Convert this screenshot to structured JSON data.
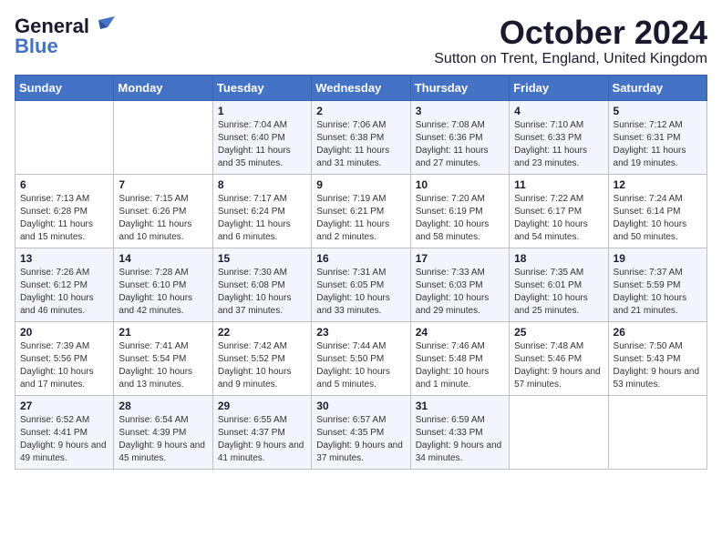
{
  "logo": {
    "general": "General",
    "blue": "Blue"
  },
  "title": "October 2024",
  "location": "Sutton on Trent, England, United Kingdom",
  "days_of_week": [
    "Sunday",
    "Monday",
    "Tuesday",
    "Wednesday",
    "Thursday",
    "Friday",
    "Saturday"
  ],
  "weeks": [
    [
      {
        "day": "",
        "sunrise": "",
        "sunset": "",
        "daylight": ""
      },
      {
        "day": "",
        "sunrise": "",
        "sunset": "",
        "daylight": ""
      },
      {
        "day": "1",
        "sunrise": "Sunrise: 7:04 AM",
        "sunset": "Sunset: 6:40 PM",
        "daylight": "Daylight: 11 hours and 35 minutes."
      },
      {
        "day": "2",
        "sunrise": "Sunrise: 7:06 AM",
        "sunset": "Sunset: 6:38 PM",
        "daylight": "Daylight: 11 hours and 31 minutes."
      },
      {
        "day": "3",
        "sunrise": "Sunrise: 7:08 AM",
        "sunset": "Sunset: 6:36 PM",
        "daylight": "Daylight: 11 hours and 27 minutes."
      },
      {
        "day": "4",
        "sunrise": "Sunrise: 7:10 AM",
        "sunset": "Sunset: 6:33 PM",
        "daylight": "Daylight: 11 hours and 23 minutes."
      },
      {
        "day": "5",
        "sunrise": "Sunrise: 7:12 AM",
        "sunset": "Sunset: 6:31 PM",
        "daylight": "Daylight: 11 hours and 19 minutes."
      }
    ],
    [
      {
        "day": "6",
        "sunrise": "Sunrise: 7:13 AM",
        "sunset": "Sunset: 6:28 PM",
        "daylight": "Daylight: 11 hours and 15 minutes."
      },
      {
        "day": "7",
        "sunrise": "Sunrise: 7:15 AM",
        "sunset": "Sunset: 6:26 PM",
        "daylight": "Daylight: 11 hours and 10 minutes."
      },
      {
        "day": "8",
        "sunrise": "Sunrise: 7:17 AM",
        "sunset": "Sunset: 6:24 PM",
        "daylight": "Daylight: 11 hours and 6 minutes."
      },
      {
        "day": "9",
        "sunrise": "Sunrise: 7:19 AM",
        "sunset": "Sunset: 6:21 PM",
        "daylight": "Daylight: 11 hours and 2 minutes."
      },
      {
        "day": "10",
        "sunrise": "Sunrise: 7:20 AM",
        "sunset": "Sunset: 6:19 PM",
        "daylight": "Daylight: 10 hours and 58 minutes."
      },
      {
        "day": "11",
        "sunrise": "Sunrise: 7:22 AM",
        "sunset": "Sunset: 6:17 PM",
        "daylight": "Daylight: 10 hours and 54 minutes."
      },
      {
        "day": "12",
        "sunrise": "Sunrise: 7:24 AM",
        "sunset": "Sunset: 6:14 PM",
        "daylight": "Daylight: 10 hours and 50 minutes."
      }
    ],
    [
      {
        "day": "13",
        "sunrise": "Sunrise: 7:26 AM",
        "sunset": "Sunset: 6:12 PM",
        "daylight": "Daylight: 10 hours and 46 minutes."
      },
      {
        "day": "14",
        "sunrise": "Sunrise: 7:28 AM",
        "sunset": "Sunset: 6:10 PM",
        "daylight": "Daylight: 10 hours and 42 minutes."
      },
      {
        "day": "15",
        "sunrise": "Sunrise: 7:30 AM",
        "sunset": "Sunset: 6:08 PM",
        "daylight": "Daylight: 10 hours and 37 minutes."
      },
      {
        "day": "16",
        "sunrise": "Sunrise: 7:31 AM",
        "sunset": "Sunset: 6:05 PM",
        "daylight": "Daylight: 10 hours and 33 minutes."
      },
      {
        "day": "17",
        "sunrise": "Sunrise: 7:33 AM",
        "sunset": "Sunset: 6:03 PM",
        "daylight": "Daylight: 10 hours and 29 minutes."
      },
      {
        "day": "18",
        "sunrise": "Sunrise: 7:35 AM",
        "sunset": "Sunset: 6:01 PM",
        "daylight": "Daylight: 10 hours and 25 minutes."
      },
      {
        "day": "19",
        "sunrise": "Sunrise: 7:37 AM",
        "sunset": "Sunset: 5:59 PM",
        "daylight": "Daylight: 10 hours and 21 minutes."
      }
    ],
    [
      {
        "day": "20",
        "sunrise": "Sunrise: 7:39 AM",
        "sunset": "Sunset: 5:56 PM",
        "daylight": "Daylight: 10 hours and 17 minutes."
      },
      {
        "day": "21",
        "sunrise": "Sunrise: 7:41 AM",
        "sunset": "Sunset: 5:54 PM",
        "daylight": "Daylight: 10 hours and 13 minutes."
      },
      {
        "day": "22",
        "sunrise": "Sunrise: 7:42 AM",
        "sunset": "Sunset: 5:52 PM",
        "daylight": "Daylight: 10 hours and 9 minutes."
      },
      {
        "day": "23",
        "sunrise": "Sunrise: 7:44 AM",
        "sunset": "Sunset: 5:50 PM",
        "daylight": "Daylight: 10 hours and 5 minutes."
      },
      {
        "day": "24",
        "sunrise": "Sunrise: 7:46 AM",
        "sunset": "Sunset: 5:48 PM",
        "daylight": "Daylight: 10 hours and 1 minute."
      },
      {
        "day": "25",
        "sunrise": "Sunrise: 7:48 AM",
        "sunset": "Sunset: 5:46 PM",
        "daylight": "Daylight: 9 hours and 57 minutes."
      },
      {
        "day": "26",
        "sunrise": "Sunrise: 7:50 AM",
        "sunset": "Sunset: 5:43 PM",
        "daylight": "Daylight: 9 hours and 53 minutes."
      }
    ],
    [
      {
        "day": "27",
        "sunrise": "Sunrise: 6:52 AM",
        "sunset": "Sunset: 4:41 PM",
        "daylight": "Daylight: 9 hours and 49 minutes."
      },
      {
        "day": "28",
        "sunrise": "Sunrise: 6:54 AM",
        "sunset": "Sunset: 4:39 PM",
        "daylight": "Daylight: 9 hours and 45 minutes."
      },
      {
        "day": "29",
        "sunrise": "Sunrise: 6:55 AM",
        "sunset": "Sunset: 4:37 PM",
        "daylight": "Daylight: 9 hours and 41 minutes."
      },
      {
        "day": "30",
        "sunrise": "Sunrise: 6:57 AM",
        "sunset": "Sunset: 4:35 PM",
        "daylight": "Daylight: 9 hours and 37 minutes."
      },
      {
        "day": "31",
        "sunrise": "Sunrise: 6:59 AM",
        "sunset": "Sunset: 4:33 PM",
        "daylight": "Daylight: 9 hours and 34 minutes."
      },
      {
        "day": "",
        "sunrise": "",
        "sunset": "",
        "daylight": ""
      },
      {
        "day": "",
        "sunrise": "",
        "sunset": "",
        "daylight": ""
      }
    ]
  ]
}
